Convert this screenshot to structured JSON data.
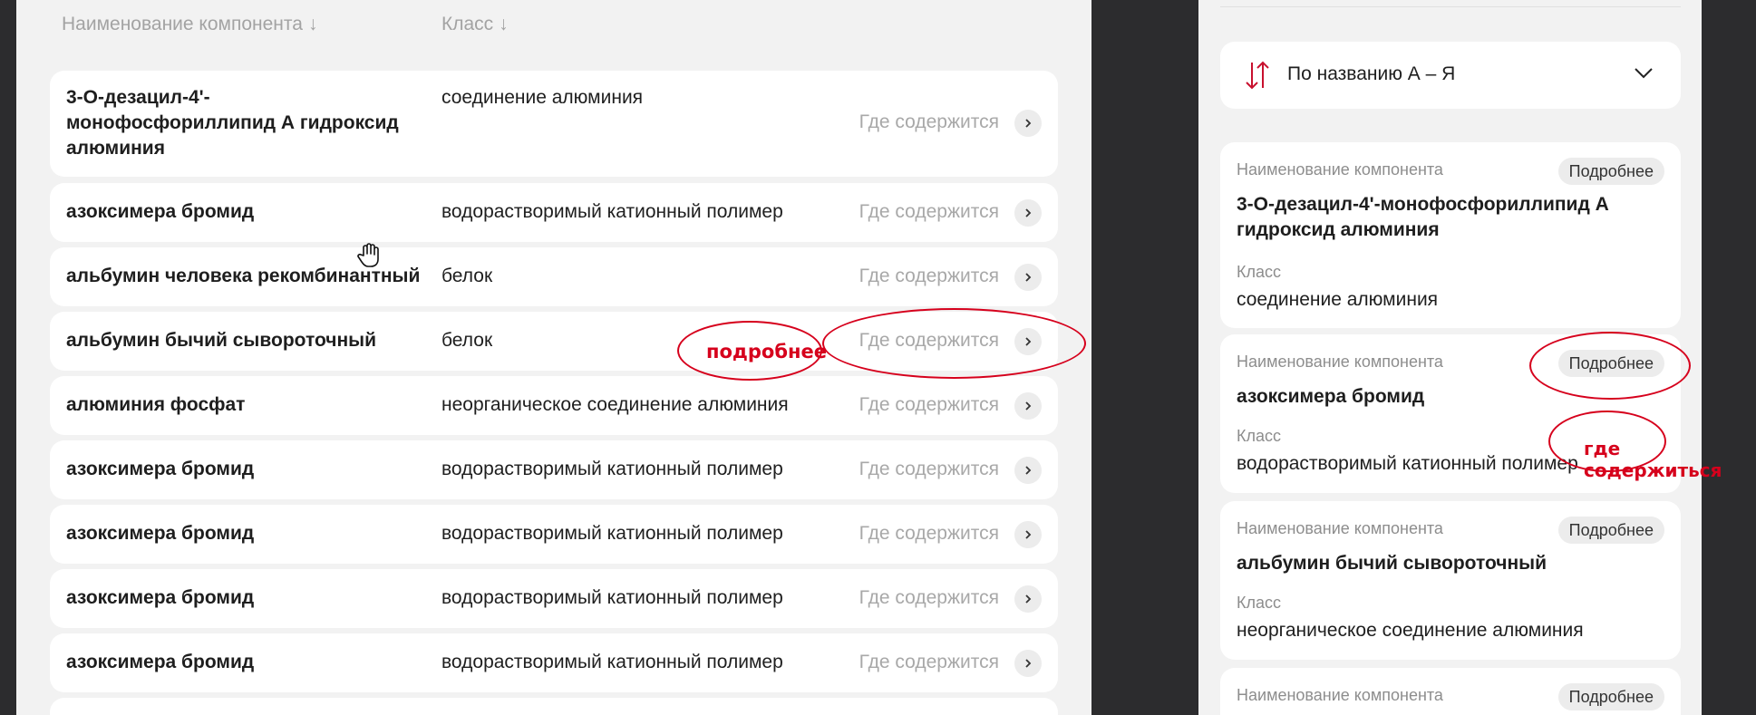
{
  "table": {
    "header_name": "Наименование компонента",
    "header_class": "Класс",
    "sort_arrow": "↓",
    "where_label": "Где содержится",
    "rows": [
      {
        "name": "3-О-дезацил-4'-монофосфориллипид А гидроксид алюминия",
        "name_lines": [
          "3-О-дезацил-4'-",
          "монофосфориллипид А гидроксид",
          "алюминия"
        ],
        "class": "соединение алюминия"
      },
      {
        "name": "азоксимера бромид",
        "class": "водорастворимый катионный полимер"
      },
      {
        "name": "альбумин человека рекомбинантный",
        "class": "белок"
      },
      {
        "name": "альбумин бычий сывороточный",
        "class": "белок"
      },
      {
        "name": "алюминия фосфат",
        "class": "неорганическое соединение алюминия"
      },
      {
        "name": "азоксимера бромид",
        "class": "водорастворимый катионный полимер"
      },
      {
        "name": "азоксимера бромид",
        "class": "водорастворимый катионный полимер"
      },
      {
        "name": "азоксимера бромид",
        "class": "водорастворимый катионный полимер"
      },
      {
        "name": "азоксимера бромид",
        "class": "водорастворимый катионный полимер"
      }
    ]
  },
  "mobile": {
    "sort_label": "По названию А – Я",
    "name_label": "Наименование компонента",
    "class_label": "Класс",
    "more_label": "Подробнее",
    "cards": [
      {
        "name_lines": [
          "3-О-дезацил-4'-монофосфориллипид А",
          "гидроксид алюминия"
        ],
        "class": "соединение алюминия"
      },
      {
        "name_lines": [
          "азоксимера бромид"
        ],
        "class": "водорастворимый катионный полимер"
      },
      {
        "name_lines": [
          "альбумин бычий сывороточный"
        ],
        "class": "неорганическое соединение алюминия"
      },
      {
        "name_lines": [],
        "class": ""
      }
    ]
  },
  "annotations": {
    "note_more": "подробнее",
    "note_where": "где содержиться",
    "color": "#d6001c"
  },
  "icons": {
    "cursor": "hand-cursor-icon",
    "row_chevron": "chevron-right-icon",
    "sort": "sort-arrows-icon",
    "dropdown": "chevron-down-icon"
  }
}
